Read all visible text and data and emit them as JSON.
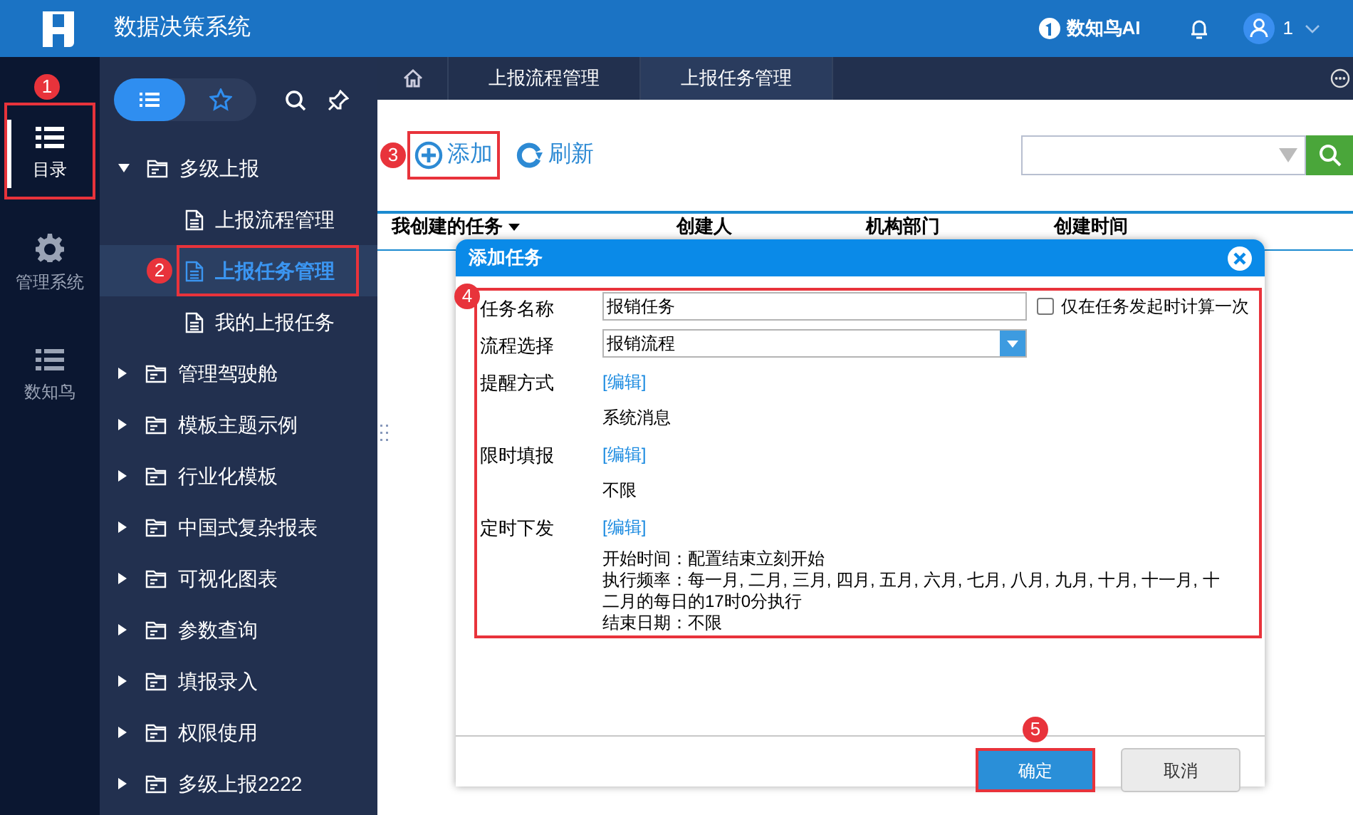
{
  "header": {
    "title": "数据决策系统",
    "ai_label": "数知鸟AI",
    "user": "1"
  },
  "rail": [
    {
      "label": "目录",
      "selected": true,
      "badge": "1"
    },
    {
      "label": "管理系统",
      "selected": false
    },
    {
      "label": "数知鸟",
      "selected": false
    }
  ],
  "tree_toggle": [
    {
      "selected": true
    },
    {
      "selected": false
    }
  ],
  "tree": [
    {
      "label": "多级上报",
      "expanded": true,
      "selected": false,
      "children": [
        {
          "label": "上报流程管理",
          "selected": false
        },
        {
          "label": "上报任务管理",
          "selected": true,
          "badge": "2"
        },
        {
          "label": "我的上报任务",
          "selected": false
        }
      ]
    },
    {
      "label": "管理驾驶舱",
      "expanded": false,
      "selected": false
    },
    {
      "label": "模板主题示例",
      "expanded": false,
      "selected": false
    },
    {
      "label": "行业化模板",
      "expanded": false,
      "selected": false
    },
    {
      "label": "中国式复杂报表",
      "expanded": false,
      "selected": false
    },
    {
      "label": "可视化图表",
      "expanded": false,
      "selected": false
    },
    {
      "label": "参数查询",
      "expanded": false,
      "selected": false
    },
    {
      "label": "填报录入",
      "expanded": false,
      "selected": false
    },
    {
      "label": "权限使用",
      "expanded": false,
      "selected": false
    },
    {
      "label": "多级上报2222",
      "expanded": false,
      "selected": false
    }
  ],
  "tabs": [
    {
      "label": "上报流程管理",
      "selected": false
    },
    {
      "label": "上报任务管理",
      "selected": true
    }
  ],
  "toolbar": [
    {
      "kind": "add",
      "label": "添加",
      "badge": "3"
    },
    {
      "kind": "refresh",
      "label": "刷新"
    }
  ],
  "table": {
    "columns": [
      "我创建的任务",
      "创建人",
      "机构部门",
      "创建时间"
    ]
  },
  "dialog": {
    "title": "添加任务",
    "badge": "4",
    "rows": [
      {
        "kind": "input",
        "label": "任务名称",
        "value": "报销任务",
        "checkbox": {
          "label": "仅在任务发起时计算一次",
          "checked": false
        }
      },
      {
        "kind": "select",
        "label": "流程选择",
        "value": "报销流程"
      },
      {
        "kind": "edit",
        "label": "提醒方式",
        "link": "[编辑]",
        "lines": [
          "系统消息"
        ]
      },
      {
        "kind": "edit",
        "label": "限时填报",
        "link": "[编辑]",
        "lines": [
          "不限"
        ]
      },
      {
        "kind": "edit",
        "label": "定时下发",
        "link": "[编辑]",
        "lines": [
          "开始时间：配置结束立刻开始",
          "执行频率：每一月, 二月, 三月, 四月, 五月, 六月, 七月, 八月, 九月, 十月, 十一月, 十",
          "二月的每日的17时0分执行",
          "结束日期：不限"
        ]
      }
    ],
    "buttons": [
      {
        "kind": "primary",
        "label": "确定",
        "badge": "5"
      },
      {
        "kind": "secondary",
        "label": "取消"
      }
    ]
  }
}
